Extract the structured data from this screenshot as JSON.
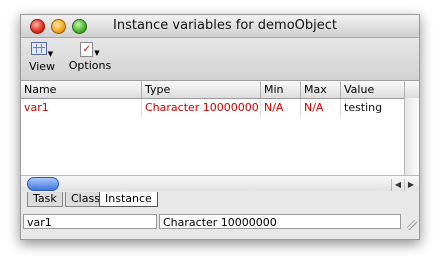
{
  "window": {
    "title": "Instance variables for demoObject"
  },
  "toolbar": {
    "view_label": "View",
    "view_icon": "grid-icon",
    "options_label": "Options",
    "options_icon": "checkbox-icon"
  },
  "table": {
    "headers": {
      "name": "Name",
      "type": "Type",
      "min": "Min",
      "max": "Max",
      "value": "Value"
    },
    "rows": [
      {
        "name": "var1",
        "type": "Character   10000000",
        "min": "N/A",
        "max": "N/A",
        "value": "testing"
      }
    ]
  },
  "tabs": [
    {
      "label": "Task"
    },
    {
      "label": "Class"
    },
    {
      "label": "Instance",
      "active": true
    }
  ],
  "status": {
    "name": "var1",
    "type": "Character   10000000"
  },
  "colors": {
    "row_text": "#cc0000",
    "scroll_thumb": "#3e78d8"
  }
}
